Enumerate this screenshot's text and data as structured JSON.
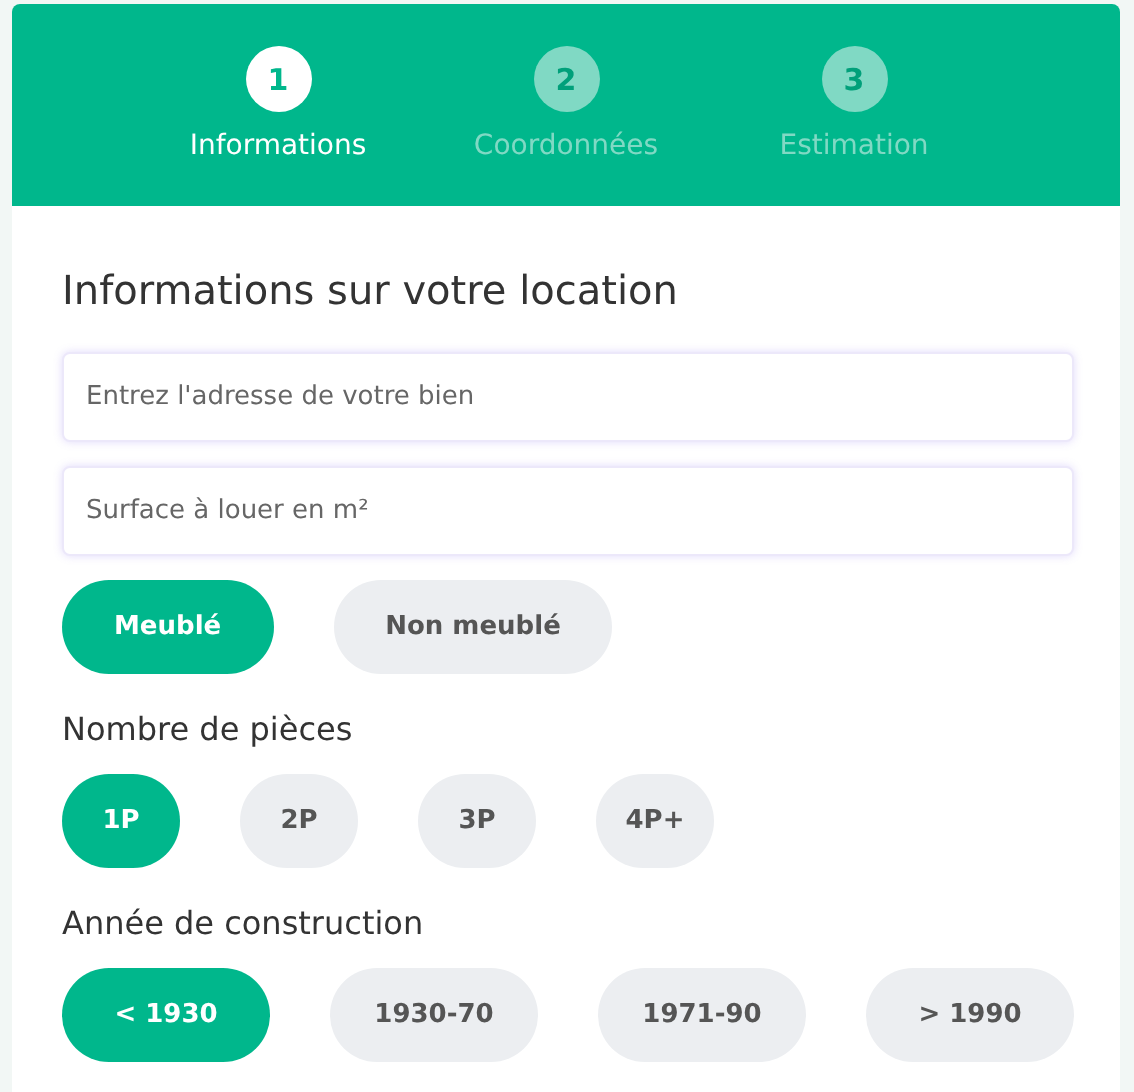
{
  "steps": [
    {
      "number": "1",
      "label": "Informations",
      "selected": true
    },
    {
      "number": "2",
      "label": "Coordonnées",
      "selected": false
    },
    {
      "number": "3",
      "label": "Estimation",
      "selected": false
    }
  ],
  "form": {
    "title": "Informations sur votre location",
    "fields": [
      {
        "placeholder": "Entrez l'adresse de votre bien"
      },
      {
        "placeholder": "Surface à louer en m²"
      }
    ],
    "furnished": [
      {
        "label": "Meublé",
        "selected": true
      },
      {
        "label": "Non meublé",
        "selected": false
      }
    ],
    "groups": [
      {
        "label": "Nombre de pièces",
        "options": [
          {
            "label": "1P",
            "selected": true
          },
          {
            "label": "2P",
            "selected": false
          },
          {
            "label": "3P",
            "selected": false
          },
          {
            "label": "4P+",
            "selected": false
          }
        ]
      },
      {
        "label": "Année de construction",
        "options": [
          {
            "label": "< 1930",
            "selected": true
          },
          {
            "label": "1930-70",
            "selected": false
          },
          {
            "label": "1971-90",
            "selected": false
          },
          {
            "label": "> 1990",
            "selected": false
          }
        ]
      }
    ]
  }
}
